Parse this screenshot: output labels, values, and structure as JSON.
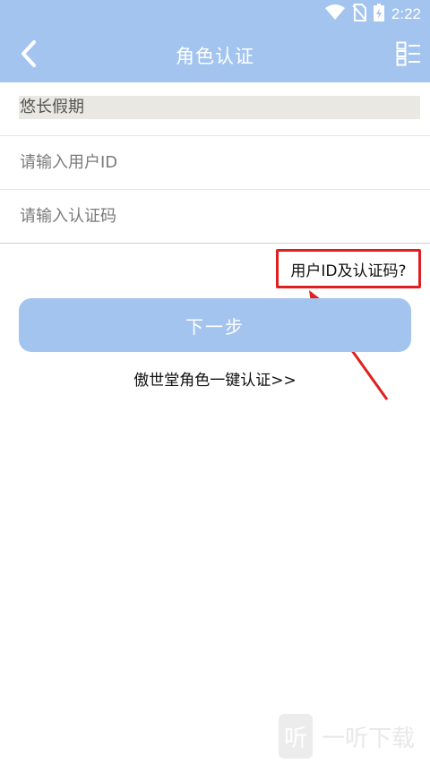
{
  "status_bar": {
    "time": "2:22",
    "icons": [
      "wifi-icon",
      "no-sim-icon",
      "battery-charging-icon"
    ]
  },
  "app_bar": {
    "title": "角色认证",
    "back_icon": "chevron-left-icon",
    "menu_icon": "list-menu-icon"
  },
  "form": {
    "server_value": "悠长假期",
    "user_id": {
      "value": "",
      "placeholder": "请输入用户ID"
    },
    "auth_code": {
      "value": "",
      "placeholder": "请输入认证码"
    }
  },
  "help_link": "用户ID及认证码?",
  "next_button": "下一步",
  "one_key_link": "傲世堂角色一键认证>>",
  "watermark": {
    "logo_glyph": "听",
    "text": "一听下载"
  },
  "colors": {
    "accent": "#a3c4ef",
    "annotation": "#e02020"
  }
}
